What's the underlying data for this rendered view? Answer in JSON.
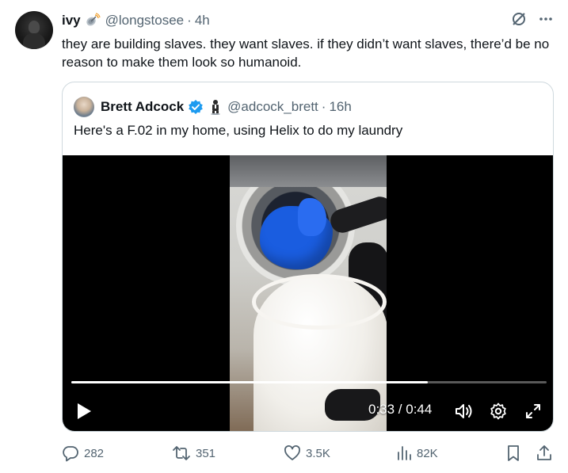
{
  "author": {
    "name": "ivy",
    "name_emoji_icon": "satellite-antenna-emoji",
    "handle": "@longstosee",
    "separator": "·",
    "time": "4h"
  },
  "tweet": {
    "text": "they are building slaves. they want slaves. if they didn’t want slaves, there’d be no reason to make them look so humanoid."
  },
  "top_icons": [
    "grok-icon",
    "more-icon"
  ],
  "quoted": {
    "name": "Brett Adcock",
    "verified_icon": "verified-badge-icon",
    "emoji_icon": "person-in-suit-levitating-emoji",
    "handle": "@adcock_brett",
    "separator": "·",
    "time": "16h",
    "text": "Here's a F.02 in my home, using Helix to do my laundry",
    "video": {
      "current_time": "0:33",
      "duration": "0:44",
      "time_display": "0:33 / 0:44",
      "progress": 0.75
    }
  },
  "actions": {
    "replies": "282",
    "reposts": "351",
    "likes": "3.5K",
    "views": "82K"
  },
  "colors": {
    "text": "#0f1419",
    "secondary": "#536471",
    "border": "#cfd9de",
    "verified": "#1d9bf0",
    "video_bg": "#000000"
  }
}
